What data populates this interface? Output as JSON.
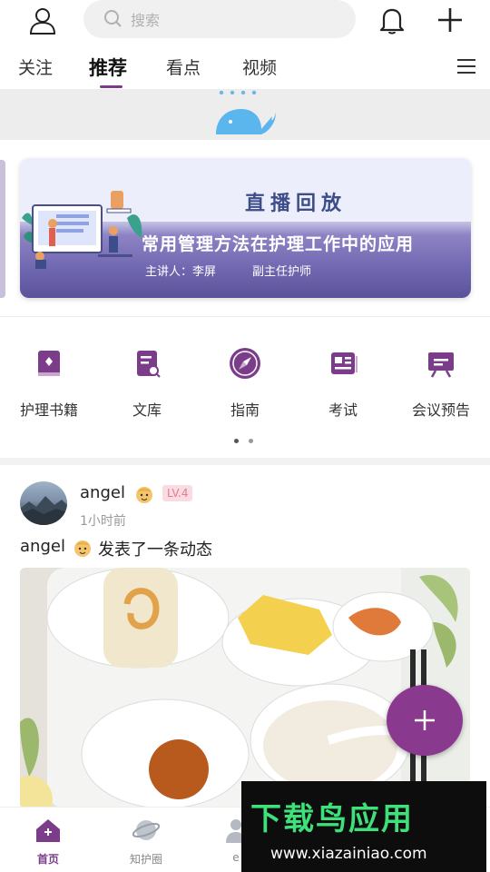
{
  "header": {
    "search_placeholder": "搜索",
    "icons": [
      "user-icon",
      "search-icon",
      "bell-icon",
      "plus-icon"
    ]
  },
  "tabs": [
    {
      "label": "关注",
      "active": false
    },
    {
      "label": "推荐",
      "active": true
    },
    {
      "label": "看点",
      "active": false
    },
    {
      "label": "视频",
      "active": false
    }
  ],
  "banner": {
    "title": "直播回放",
    "headline": "常用管理方法在护理工作中的应用",
    "speaker": "主讲人：李屏",
    "role": "副主任护师"
  },
  "quick_entries": [
    {
      "label": "护理书籍",
      "icon": "book-icon"
    },
    {
      "label": "文库",
      "icon": "library-icon"
    },
    {
      "label": "指南",
      "icon": "compass-icon"
    },
    {
      "label": "考试",
      "icon": "exam-icon"
    },
    {
      "label": "会议预告",
      "icon": "meeting-icon"
    }
  ],
  "post": {
    "username": "angel",
    "level": "LV.4",
    "time": "1小时前",
    "text_prefix": "angel",
    "text_rest": " 发表了一条动态"
  },
  "bottom_nav": [
    {
      "label": "首页",
      "active": true,
      "icon": "home-icon"
    },
    {
      "label": "知护圈",
      "active": false,
      "icon": "planet-icon"
    },
    {
      "label": "e",
      "active": false,
      "icon": "doctor-icon"
    }
  ],
  "watermark": {
    "title": "下载鸟应用",
    "url": "www.xiazainiao.com"
  },
  "colors": {
    "accent": "#7b3d8a",
    "fab": "#8a3a8e",
    "badge_bg": "#f9dbe2",
    "badge_text": "#e57a93"
  }
}
